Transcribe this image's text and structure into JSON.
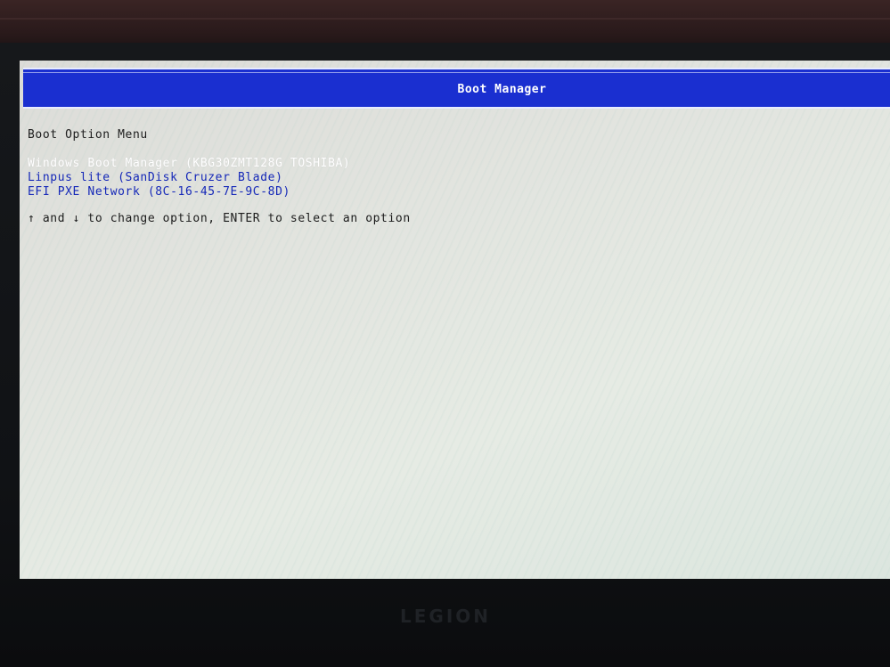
{
  "bios": {
    "title": "Boot Manager",
    "menu_header": "Boot Option Menu",
    "options": [
      {
        "label": "Windows Boot Manager (KBG30ZMT128G TOSHIBA)",
        "selected": true
      },
      {
        "label": "Linpus lite (SanDisk Cruzer Blade)",
        "selected": false
      },
      {
        "label": "EFI PXE Network (8C-16-45-7E-9C-8D)",
        "selected": false
      }
    ],
    "hint": "↑ and ↓ to change option, ENTER to select an option"
  },
  "laptop": {
    "brand": "LEGION"
  },
  "colors": {
    "title_bar": "#1a2fd0",
    "option_text": "#1528b8",
    "selected_text": "#ffffff",
    "screen_bg": "#e2e4df"
  }
}
